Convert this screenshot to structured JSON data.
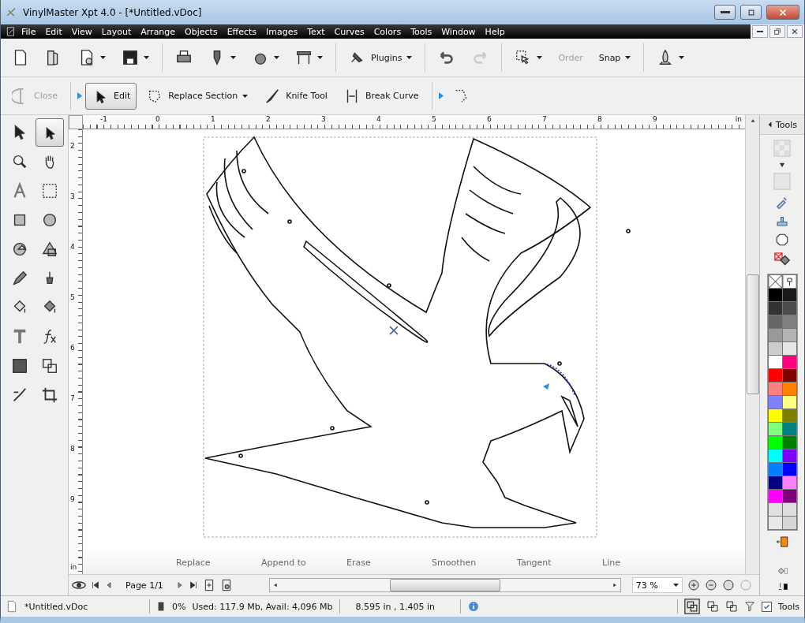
{
  "window": {
    "title": "VinylMaster Xpt 4.0 - [*Untitled.vDoc]"
  },
  "menu": [
    "File",
    "Edit",
    "View",
    "Layout",
    "Arrange",
    "Objects",
    "Effects",
    "Images",
    "Text",
    "Curves",
    "Colors",
    "Tools",
    "Window",
    "Help"
  ],
  "toolbar": [
    {
      "kind": "icon",
      "dropdown": false,
      "disabled": false
    },
    {
      "kind": "icon",
      "dropdown": false,
      "disabled": false
    },
    {
      "kind": "icon",
      "dropdown": true,
      "disabled": false
    },
    {
      "kind": "icon",
      "dropdown": true,
      "disabled": false
    },
    {
      "kind": "icon",
      "dropdown": false,
      "disabled": false
    },
    {
      "kind": "icon",
      "dropdown": true,
      "disabled": false
    },
    {
      "kind": "icon",
      "dropdown": true,
      "disabled": false
    },
    {
      "kind": "icon",
      "dropdown": true,
      "disabled": false
    },
    {
      "kind": "text",
      "label": "Plugins",
      "dropdown": true,
      "disabled": false
    },
    {
      "kind": "icon",
      "dropdown": false,
      "disabled": false
    },
    {
      "kind": "icon",
      "dropdown": false,
      "disabled": true
    },
    {
      "kind": "icon",
      "dropdown": true,
      "disabled": false
    },
    {
      "kind": "text",
      "label": "Order",
      "dropdown": false,
      "disabled": true
    },
    {
      "kind": "text",
      "label": "Snap",
      "dropdown": true,
      "disabled": false
    },
    {
      "kind": "icon",
      "dropdown": true,
      "disabled": false
    }
  ],
  "edit_toolbar": [
    {
      "label": "Close",
      "disabled": true,
      "selected": false,
      "dropdown": false
    },
    {
      "label": "Edit",
      "disabled": false,
      "selected": true,
      "dropdown": false
    },
    {
      "label": "Replace Section",
      "disabled": false,
      "selected": false,
      "dropdown": true
    },
    {
      "label": "Knife Tool",
      "disabled": false,
      "selected": false,
      "dropdown": false
    },
    {
      "label": "Break Curve",
      "disabled": false,
      "selected": false,
      "dropdown": false
    }
  ],
  "tools": [
    {
      "selected": false
    },
    {
      "selected": true
    },
    {
      "selected": false
    },
    {
      "selected": false
    },
    {
      "selected": false
    },
    {
      "selected": false
    },
    {
      "selected": false
    },
    {
      "selected": false
    },
    {
      "selected": false
    },
    {
      "selected": false
    },
    {
      "selected": false
    },
    {
      "selected": false
    },
    {
      "selected": false
    },
    {
      "selected": false
    },
    {
      "selected": false
    },
    {
      "selected": false
    },
    {
      "selected": false
    },
    {
      "selected": false
    },
    {
      "selected": false
    },
    {
      "selected": false
    }
  ],
  "ruler": {
    "horizontal": [
      "-1",
      "0",
      "1",
      "2",
      "3",
      "4",
      "5",
      "6",
      "7",
      "8",
      "9"
    ],
    "unit": "in",
    "vertical": [
      "2",
      "3",
      "4",
      "5",
      "6",
      "7",
      "8",
      "9"
    ],
    "vertical_unit": "in"
  },
  "node_modes": [
    "Replace",
    "Append to",
    "Erase",
    "Smoothen",
    "Tangent",
    "Line"
  ],
  "page_nav": {
    "page": "Page 1/1",
    "zoom": "73 %"
  },
  "tools_panel": {
    "title": "Tools"
  },
  "palette": [
    {
      "color": "#000000"
    },
    {
      "color": "#1a1a1a"
    },
    {
      "color": "#333333"
    },
    {
      "color": "#4d4d4d"
    },
    {
      "color": "#666666"
    },
    {
      "color": "#808080"
    },
    {
      "color": "#999999"
    },
    {
      "color": "#b3b3b3"
    },
    {
      "color": "#cccccc"
    },
    {
      "color": "#e6e6e6"
    },
    {
      "color": "#ffffff"
    },
    {
      "color": "#ff0080"
    },
    {
      "color": "#ff0000"
    },
    {
      "color": "#800000"
    },
    {
      "color": "#ff8080"
    },
    {
      "color": "#ff8000"
    },
    {
      "color": "#8080ff"
    },
    {
      "color": "#ffff80"
    },
    {
      "color": "#ffff00"
    },
    {
      "color": "#808000"
    },
    {
      "color": "#80ff80"
    },
    {
      "color": "#008080"
    },
    {
      "color": "#00ff00"
    },
    {
      "color": "#008000"
    },
    {
      "color": "#00ffff"
    },
    {
      "color": "#8000ff"
    },
    {
      "color": "#0080ff"
    },
    {
      "color": "#0000ff"
    },
    {
      "color": "#000080"
    },
    {
      "color": "#ff80ff"
    },
    {
      "color": "#ff00ff"
    },
    {
      "color": "#800080"
    },
    {
      "color": "#e0e0e0"
    },
    {
      "color": "#dedede"
    },
    {
      "color": "#e8e8e8"
    },
    {
      "color": "#d6d6d6"
    }
  ],
  "status_bar": {
    "file": "*Untitled.vDoc",
    "memory_percent": "0%",
    "memory": "Used: 117.9 Mb, Avail: 4,096 Mb",
    "position": "8.595 in , 1.405 in",
    "tools_toggle": {
      "label": "Tools",
      "checked": true
    }
  }
}
